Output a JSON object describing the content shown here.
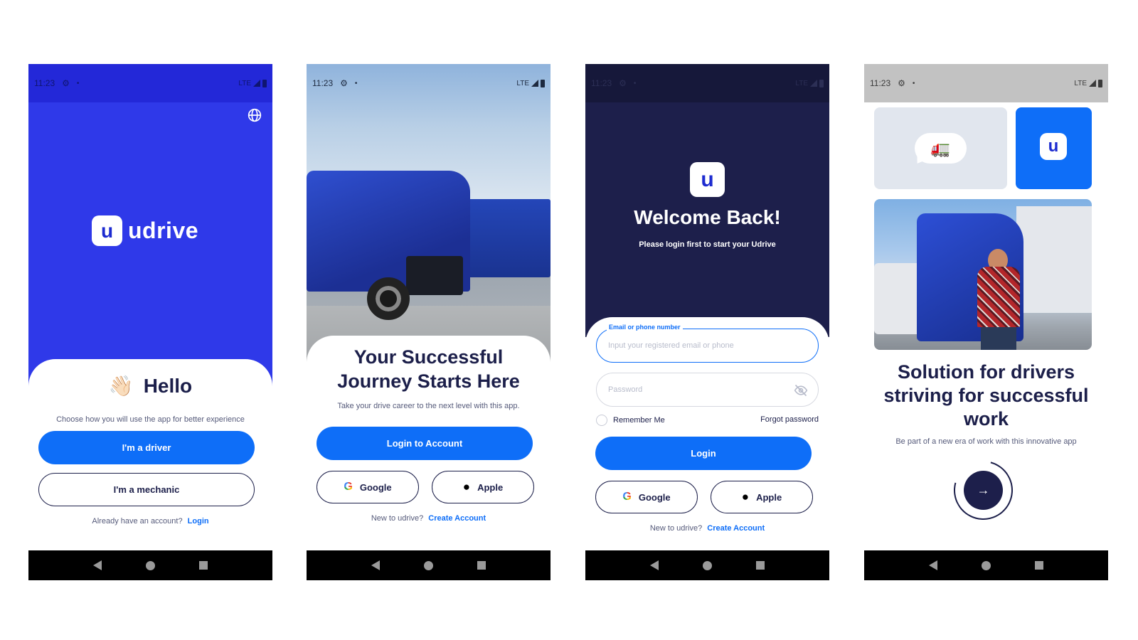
{
  "status": {
    "time": "11:23",
    "network": "LTE"
  },
  "brand": {
    "name": "udrive",
    "logo_letter": "u"
  },
  "screen1": {
    "greeting": "Hello",
    "wave_emoji": "👋🏻",
    "subtitle": "Choose how you will use the app for better experience",
    "driver_button": "I'm a driver",
    "mechanic_button": "I'm a mechanic",
    "footer_text": "Already have an account?",
    "footer_link": "Login"
  },
  "screen2": {
    "title": "Your Successful Journey Starts Here",
    "subtitle": "Take your drive career to the next level with this  app.",
    "login_button": "Login to Account",
    "google_button": "Google",
    "apple_button": "Apple",
    "footer_text": "New to udrive?",
    "footer_link": "Create Account"
  },
  "screen3": {
    "title": "Welcome Back!",
    "subtitle": "Please login first to start your Udrive",
    "email_label": "Email or phone number",
    "email_placeholder": "Input your registered email or phone",
    "password_placeholder": "Password",
    "remember_me": "Remember Me",
    "forgot_password": "Forgot password",
    "login_button": "Login",
    "google_button": "Google",
    "apple_button": "Apple",
    "footer_text": "New to udrive?",
    "footer_link": "Create Account"
  },
  "screen4": {
    "chat_emoji": "🚛",
    "title": "Solution for drivers striving for successful work",
    "subtitle": "Be part of a new era of work with this innovative app",
    "next_arrow": "→"
  },
  "colors": {
    "primary": "#0e6ef8",
    "brand_blue": "#2f39e9",
    "navy": "#1d1f4b",
    "accent_green": "#21c38e"
  }
}
